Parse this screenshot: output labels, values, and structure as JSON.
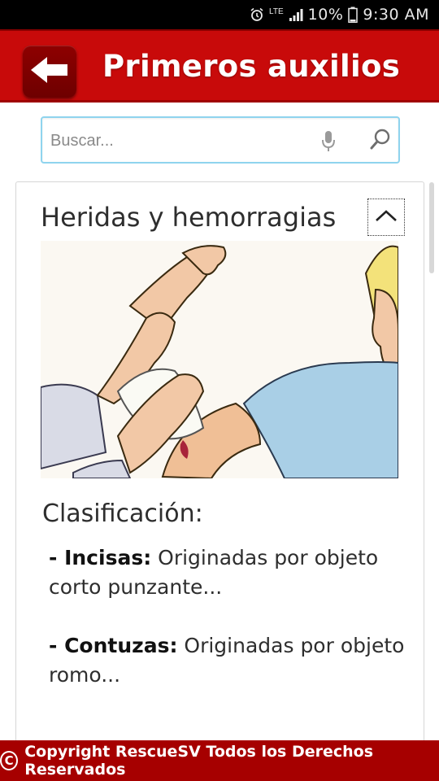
{
  "status_bar": {
    "network": "LTE",
    "battery": "10%",
    "time": "9:30 AM",
    "icons": [
      "alarm-icon",
      "signal-icon",
      "battery-icon"
    ]
  },
  "app_bar": {
    "title": "Primeros auxilios",
    "back_icon": "arrow-left-icon",
    "color": "#c80a0a"
  },
  "search": {
    "placeholder": "Buscar...",
    "value": "",
    "icons": [
      "mic-icon",
      "search-icon"
    ]
  },
  "card": {
    "title": "Heridas y hemorragias",
    "collapse_icon": "chevron-up-icon",
    "section_heading": "Clasificación:",
    "items": [
      {
        "term": "- Incisas:",
        "text": " Originadas por objeto corto punzante..."
      },
      {
        "term": "- Contuzas:",
        "text": " Originadas por objeto romo..."
      }
    ]
  },
  "footer": {
    "symbol": "C",
    "text": "Copyright RescueSV Todos los Derechos Reservados",
    "color": "#a60000"
  }
}
